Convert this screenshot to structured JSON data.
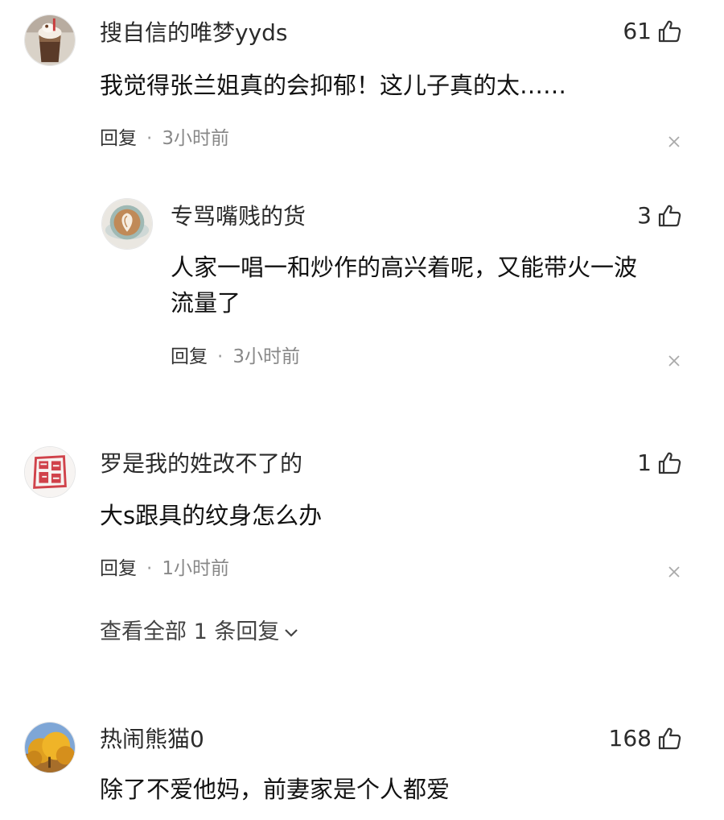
{
  "comments": [
    {
      "username": "搜自信的唯梦yyds",
      "likes": "61",
      "text": "我觉得张兰姐真的会抑郁！这儿子真的太……",
      "reply_label": "回复",
      "separator": "·",
      "time": "3小时前",
      "avatar": "iced-coffee-drink"
    },
    {
      "username": "专骂嘴贱的货",
      "likes": "3",
      "text_line1": "人家一唱一和炒作的高兴着呢，又能带火一波",
      "text_line2": "流量了",
      "reply_label": "回复",
      "separator": "·",
      "time": "3小时前",
      "avatar": "latte-art-cup"
    },
    {
      "username": "罗是我的姓改不了的",
      "likes": "1",
      "text": "大s跟具的纹身怎么办",
      "reply_label": "回复",
      "separator": "·",
      "time": "1小时前",
      "avatar": "red-seal-stamp",
      "more_replies": "查看全部 1 条回复"
    },
    {
      "username": "热闹熊猫0",
      "likes": "168",
      "text": "除了不爱他妈，前妻家是个人都爱",
      "avatar": "autumn-tree-landscape"
    }
  ],
  "colors": {
    "text": "#111111",
    "meta": "#888888",
    "icon": "#333333"
  }
}
